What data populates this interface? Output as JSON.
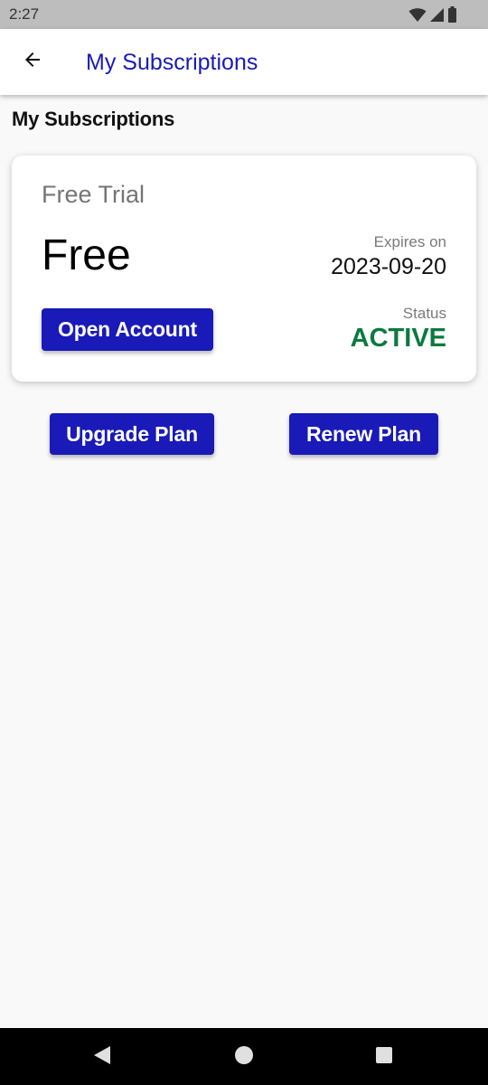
{
  "status_bar": {
    "time": "2:27",
    "icons": [
      "wifi-icon",
      "signal-icon",
      "battery-icon"
    ]
  },
  "app_bar": {
    "back_icon": "arrow-left-icon",
    "title": "My Subscriptions"
  },
  "page": {
    "section_title": "My Subscriptions"
  },
  "subscription_card": {
    "plan_name": "Free Trial",
    "price": "Free",
    "expires_label": "Expires on",
    "expires_value": "2023-09-20",
    "status_label": "Status",
    "status_value": "ACTIVE",
    "open_account_label": "Open Account"
  },
  "actions": {
    "upgrade_label": "Upgrade Plan",
    "renew_label": "Renew Plan"
  },
  "nav_bar": {
    "icons": [
      "back-triangle-icon",
      "home-circle-icon",
      "recents-square-icon"
    ]
  },
  "colors": {
    "accent": "#1a1ab8",
    "status_active": "#0a7a3e",
    "background": "#f9f9f9",
    "status_bar": "#bdbdbd"
  }
}
